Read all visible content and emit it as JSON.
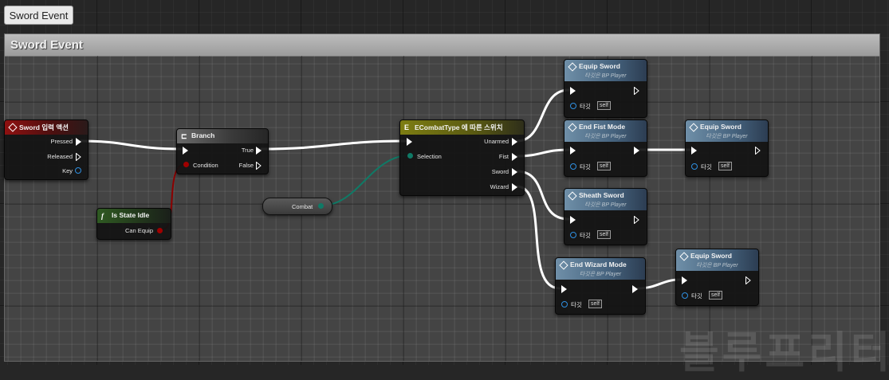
{
  "tab": {
    "label": "Sword Event"
  },
  "comment": {
    "title": "Sword Event"
  },
  "nodes": {
    "sword_input": {
      "title": "Sword 입력 액션",
      "pins": {
        "pressed": "Pressed",
        "released": "Released",
        "key": "Key"
      }
    },
    "branch": {
      "title": "Branch",
      "pins": {
        "condition": "Condition",
        "true": "True",
        "false": "False"
      }
    },
    "is_state_idle": {
      "title": "Is State Idle",
      "pins": {
        "can_equip": "Can Equip"
      }
    },
    "combat_var": {
      "label": "Combat"
    },
    "switch": {
      "title": "ECombatType 에 따른 스위치",
      "pins": {
        "selection": "Selection",
        "unarmed": "Unarmed",
        "fist": "Fist",
        "sword": "Sword",
        "wizard": "Wizard"
      }
    },
    "equip_sword_1": {
      "title": "Equip Sword",
      "subtitle": "타깃은 BP Player",
      "target": "타깃",
      "self": "self"
    },
    "end_fist_mode": {
      "title": "End Fist Mode",
      "subtitle": "타깃은 BP Player",
      "target": "타깃",
      "self": "self"
    },
    "equip_sword_2": {
      "title": "Equip Sword",
      "subtitle": "타깃은 BP Player",
      "target": "타깃",
      "self": "self"
    },
    "sheath_sword": {
      "title": "Sheath Sword",
      "subtitle": "타깃은 BP Player",
      "target": "타깃",
      "self": "self"
    },
    "end_wizard_mode": {
      "title": "End Wizard Mode",
      "subtitle": "타깃은 BP Player",
      "target": "타깃",
      "self": "self"
    },
    "equip_sword_3": {
      "title": "Equip Sword",
      "subtitle": "타깃은 BP Player",
      "target": "타깃",
      "self": "self"
    }
  },
  "icons": {
    "event": "event-diamond-icon",
    "branch": "branch-icon",
    "function": "function-icon",
    "switch": "enum-switch-icon"
  },
  "colors": {
    "exec_wire": "#ffffff",
    "bool_wire": "#8c0000",
    "enum_wire": "#0f7a66",
    "object_pin": "#2f8fe0"
  },
  "watermark": "블루프리터"
}
